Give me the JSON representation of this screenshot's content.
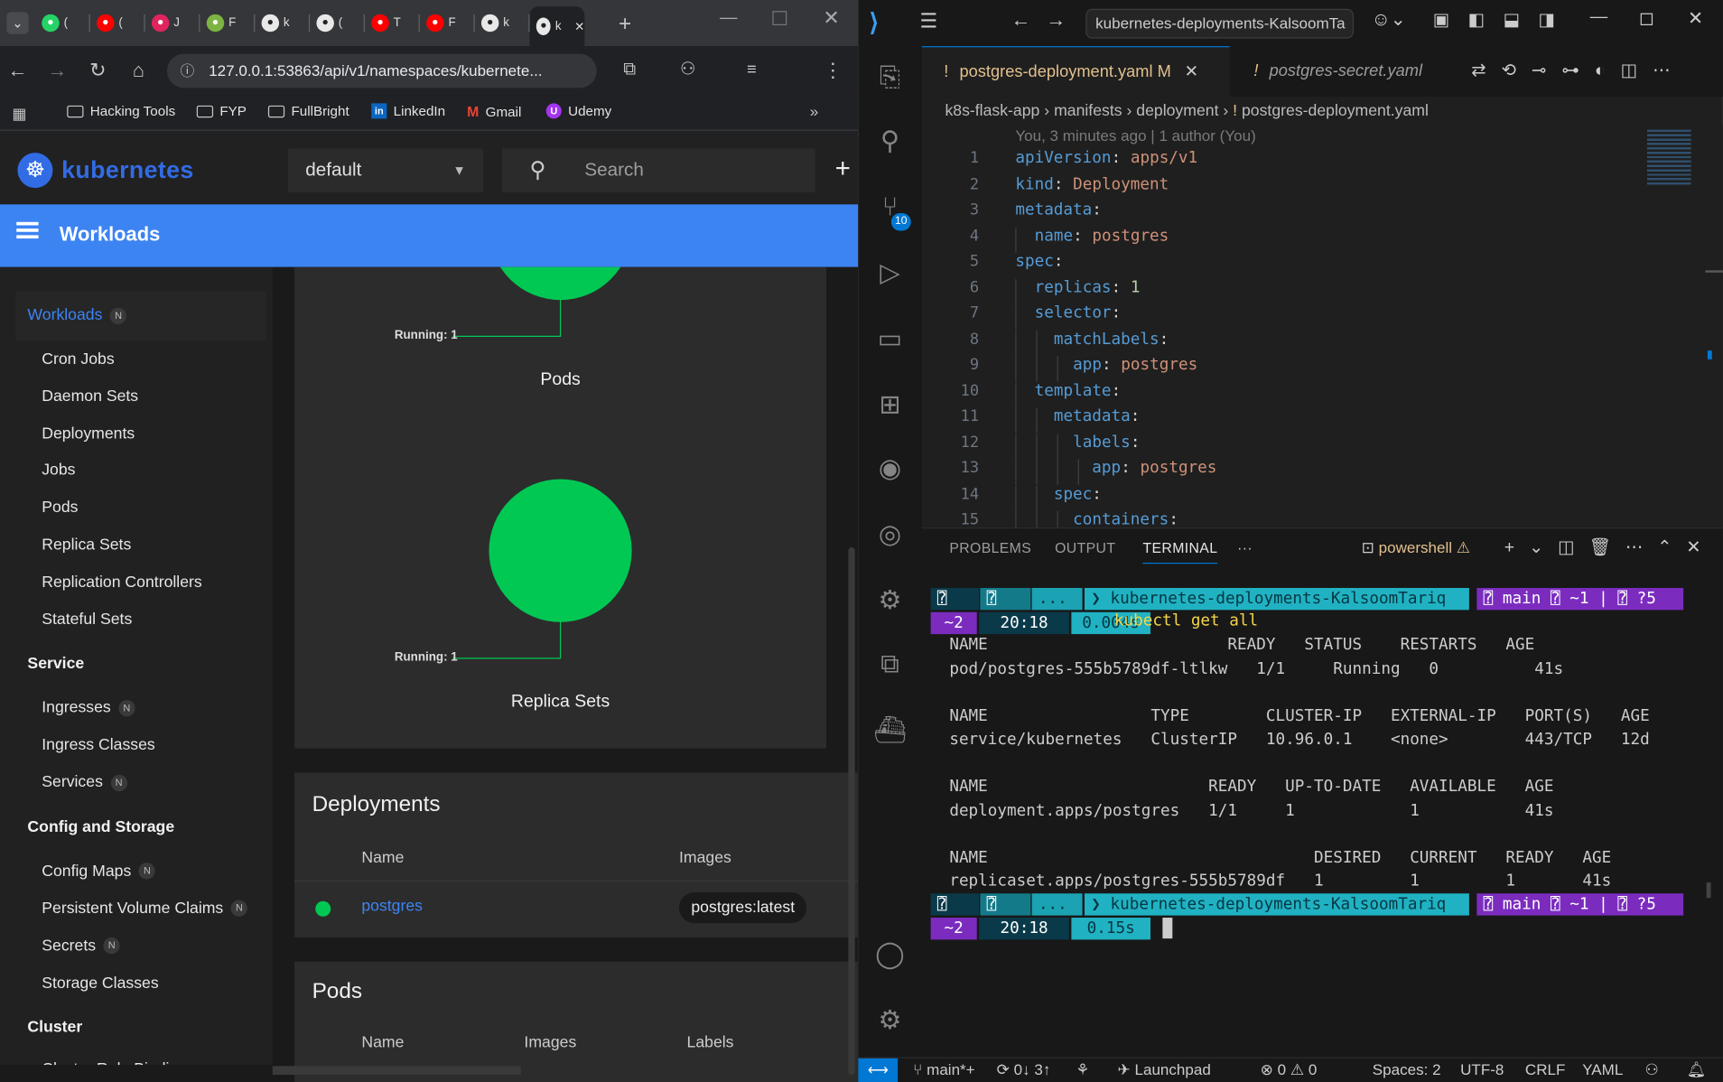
{
  "browser": {
    "tabs": [
      {
        "letter": "(",
        "icon": "whatsapp-icon",
        "color": "#25d366"
      },
      {
        "letter": "(",
        "icon": "youtube-icon",
        "color": "#ff0000"
      },
      {
        "letter": "J",
        "icon": "red-circle-icon",
        "color": "#e0245e"
      },
      {
        "letter": "F",
        "icon": "leaf-icon",
        "color": "#7cb342"
      },
      {
        "letter": "k",
        "icon": "github-icon",
        "color": "#ffffff"
      },
      {
        "letter": "(",
        "icon": "triangle-icon",
        "color": "#ffffff"
      },
      {
        "letter": "T",
        "icon": "youtube-icon",
        "color": "#ff0000"
      },
      {
        "letter": "F",
        "icon": "youtube-icon",
        "color": "#ff0000"
      },
      {
        "letter": "k",
        "icon": "openai-icon",
        "color": "#ffffff"
      },
      {
        "letter": "k",
        "icon": "page-icon",
        "color": "#ffffff",
        "active": true
      }
    ],
    "url": "127.0.0.1:53863/api/v1/namespaces/kubernete...",
    "bookmarks": [
      "Hacking Tools",
      "FYP",
      "FullBright",
      "LinkedIn",
      "Gmail",
      "Udemy"
    ]
  },
  "k8s": {
    "brand": "kubernetes",
    "namespace": "default",
    "search_placeholder": "Search",
    "toolbar_title": "Workloads",
    "sidebar": {
      "active": "Workloads",
      "workloads": [
        "Cron Jobs",
        "Daemon Sets",
        "Deployments",
        "Jobs",
        "Pods",
        "Replica Sets",
        "Replication Controllers",
        "Stateful Sets"
      ],
      "service_header": "Service",
      "service": [
        "Ingresses",
        "Ingress Classes",
        "Services"
      ],
      "config_header": "Config and Storage",
      "config": [
        "Config Maps",
        "Persistent Volume Claims",
        "Secrets",
        "Storage Classes"
      ],
      "cluster_header": "Cluster",
      "cluster": [
        "Cluster Role Bindings"
      ],
      "badge": "N"
    },
    "pods_chart": {
      "label": "Running: 1",
      "title": "Pods",
      "running": 1
    },
    "rs_chart": {
      "label": "Running: 1",
      "title": "Replica Sets",
      "running": 1
    },
    "deployments": {
      "title": "Deployments",
      "col_name": "Name",
      "col_images": "Images",
      "row_name": "postgres",
      "row_image": "postgres:latest"
    },
    "pods": {
      "title": "Pods",
      "col_name": "Name",
      "col_images": "Images",
      "col_labels": "Labels"
    }
  },
  "vscode": {
    "title": "kubernetes-deployments-KalsoomTa",
    "scm_count": "10",
    "tabs": [
      {
        "label": "postgres-deployment.yaml",
        "modified": "M"
      },
      {
        "label": "postgres-secret.yaml"
      }
    ],
    "breadcrumb": [
      "k8s-flask-app",
      "manifests",
      "deployment",
      "postgres-deployment.yaml"
    ],
    "blame": "You, 3 minutes ago | 1 author (You)",
    "code": [
      {
        "n": "1",
        "indent": 0,
        "k": "apiVersion",
        "v": "apps/v1"
      },
      {
        "n": "2",
        "indent": 0,
        "k": "kind",
        "v": "Deployment"
      },
      {
        "n": "3",
        "indent": 0,
        "k": "metadata",
        "v": ""
      },
      {
        "n": "4",
        "indent": 1,
        "k": "name",
        "v": "postgres"
      },
      {
        "n": "5",
        "indent": 0,
        "k": "spec",
        "v": ""
      },
      {
        "n": "6",
        "indent": 1,
        "k": "replicas",
        "v": "1",
        "num": true
      },
      {
        "n": "7",
        "indent": 1,
        "k": "selector",
        "v": ""
      },
      {
        "n": "8",
        "indent": 2,
        "k": "matchLabels",
        "v": ""
      },
      {
        "n": "9",
        "indent": 3,
        "k": "app",
        "v": "postgres"
      },
      {
        "n": "10",
        "indent": 1,
        "k": "template",
        "v": ""
      },
      {
        "n": "11",
        "indent": 2,
        "k": "metadata",
        "v": ""
      },
      {
        "n": "12",
        "indent": 3,
        "k": "labels",
        "v": ""
      },
      {
        "n": "13",
        "indent": 4,
        "k": "app",
        "v": "postgres"
      },
      {
        "n": "14",
        "indent": 2,
        "k": "spec",
        "v": ""
      },
      {
        "n": "15",
        "indent": 3,
        "k": "containers",
        "v": ""
      }
    ],
    "panel_tabs": [
      "PROBLEMS",
      "OUTPUT",
      "TERMINAL",
      "···"
    ],
    "terminal_name": "powershell",
    "prompt": {
      "dots": "...",
      "dir": "kubernetes-deployments-KalsoomTariq",
      "branch": "main",
      "mod": "~1",
      "untracked": "?5",
      "stash": "~2",
      "time": "20:18",
      "dur1": "0.004s",
      "dur2": "0.15s",
      "cmd": "kubectl get all"
    },
    "output": [
      "NAME                         READY   STATUS    RESTARTS   AGE",
      "pod/postgres-555b5789df-ltlkw   1/1     Running   0          41s",
      "",
      "NAME                 TYPE        CLUSTER-IP   EXTERNAL-IP   PORT(S)   AGE",
      "service/kubernetes   ClusterIP   10.96.0.1    <none>        443/TCP   12d",
      "",
      "NAME                       READY   UP-TO-DATE   AVAILABLE   AGE",
      "deployment.apps/postgres   1/1     1            1           41s",
      "",
      "NAME                                  DESIRED   CURRENT   READY   AGE",
      "replicaset.apps/postgres-555b5789df   1         1         1       41s"
    ],
    "status": {
      "branch": "main*+",
      "sync": "0↓ 3↑",
      "launchpad": "Launchpad",
      "errors": "0",
      "warnings": "0",
      "spaces": "Spaces: 2",
      "encoding": "UTF-8",
      "eol": "CRLF",
      "lang": "YAML"
    }
  }
}
